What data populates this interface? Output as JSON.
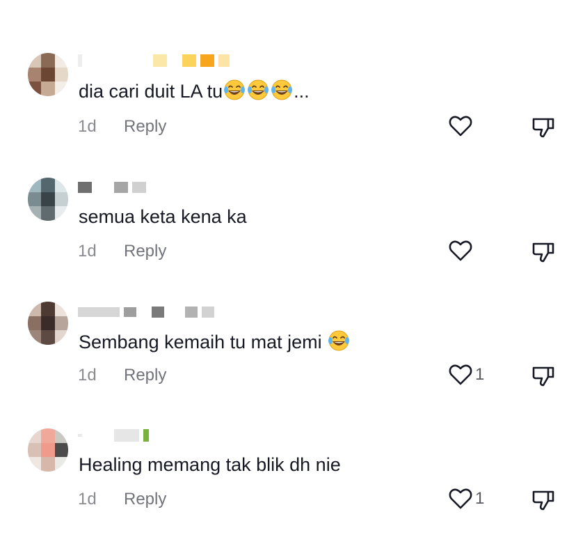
{
  "comments": [
    {
      "text": "dia cari duit LA tu",
      "emoji_count": 3,
      "suffix": "...",
      "time": "1d",
      "reply_label": "Reply",
      "like_count": ""
    },
    {
      "text": "semua keta kena ka",
      "emoji_count": 0,
      "suffix": "",
      "time": "1d",
      "reply_label": "Reply",
      "like_count": ""
    },
    {
      "text": "Sembang kemaih tu mat jemi",
      "emoji_count": 1,
      "suffix": "",
      "time": "1d",
      "reply_label": "Reply",
      "like_count": "1"
    },
    {
      "text": "Healing memang tak blik dh nie",
      "emoji_count": 0,
      "suffix": "",
      "time": "1d",
      "reply_label": "Reply",
      "like_count": "1"
    }
  ],
  "icons": {
    "like": "heart-outline-icon",
    "dislike": "thumbs-down-outline-icon",
    "emoji": "face-with-tears-of-joy-emoji"
  },
  "colors": {
    "text": "#161823",
    "meta": "#8a8b91",
    "icon": "#161823"
  }
}
